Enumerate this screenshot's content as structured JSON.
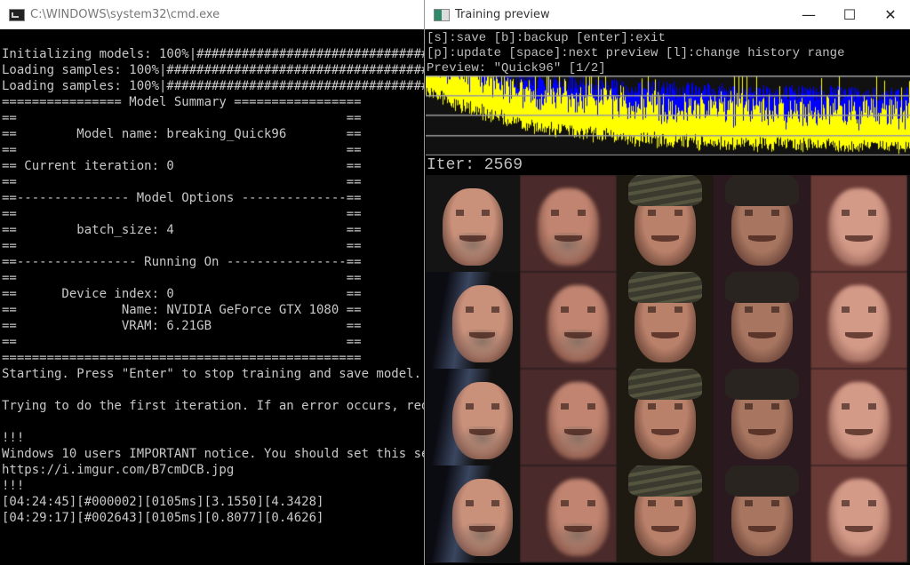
{
  "cmd_window": {
    "title": "C:\\WINDOWS\\system32\\cmd.exe",
    "icon": "console-icon",
    "lines": [
      "Initializing models: 100%|#########################################",
      "Loading samples: 100%|#############################################",
      "Loading samples: 100%|#############################################",
      "================ Model Summary =================",
      "==                                            ==",
      "==        Model name: breaking_Quick96        ==",
      "==                                            ==",
      "== Current iteration: 0                       ==",
      "==                                            ==",
      "==--------------- Model Options --------------==",
      "==                                            ==",
      "==        batch_size: 4                       ==",
      "==                                            ==",
      "==---------------- Running On ----------------==",
      "==                                            ==",
      "==      Device index: 0                       ==",
      "==              Name: NVIDIA GeForce GTX 1080 ==",
      "==              VRAM: 6.21GB                  ==",
      "==                                            ==",
      "================================================",
      "Starting. Press \"Enter\" to stop training and save model.",
      "",
      "Trying to do the first iteration. If an error occurs, red",
      "",
      "!!!",
      "Windows 10 users IMPORTANT notice. You should set this se",
      "https://i.imgur.com/B7cmDCB.jpg",
      "!!!",
      "[04:24:45][#000002][0105ms][3.1550][4.3428]",
      "[04:29:17][#002643][0105ms][0.8077][0.4626]"
    ]
  },
  "preview_window": {
    "title": "Training preview",
    "icon": "preview-window-icon",
    "controls": {
      "minimize": "—",
      "maximize": "☐",
      "close": "✕"
    },
    "help_lines": [
      "[s]:save [b]:backup [enter]:exit",
      "[p]:update [space]:next preview [l]:change history range",
      "Preview: \"Quick96\" [1/2]"
    ],
    "iter_label": "Iter: 2569",
    "loss_graph": {
      "colors": {
        "src_loss": "#ffff00",
        "dst_loss": "#0000ff",
        "grid": "#9a9a9a",
        "background": "#111111"
      }
    },
    "preview_grid": {
      "rows": 4,
      "columns": [
        "source",
        "source-reconstruction",
        "destination",
        "destination-reconstruction",
        "swap"
      ]
    }
  }
}
